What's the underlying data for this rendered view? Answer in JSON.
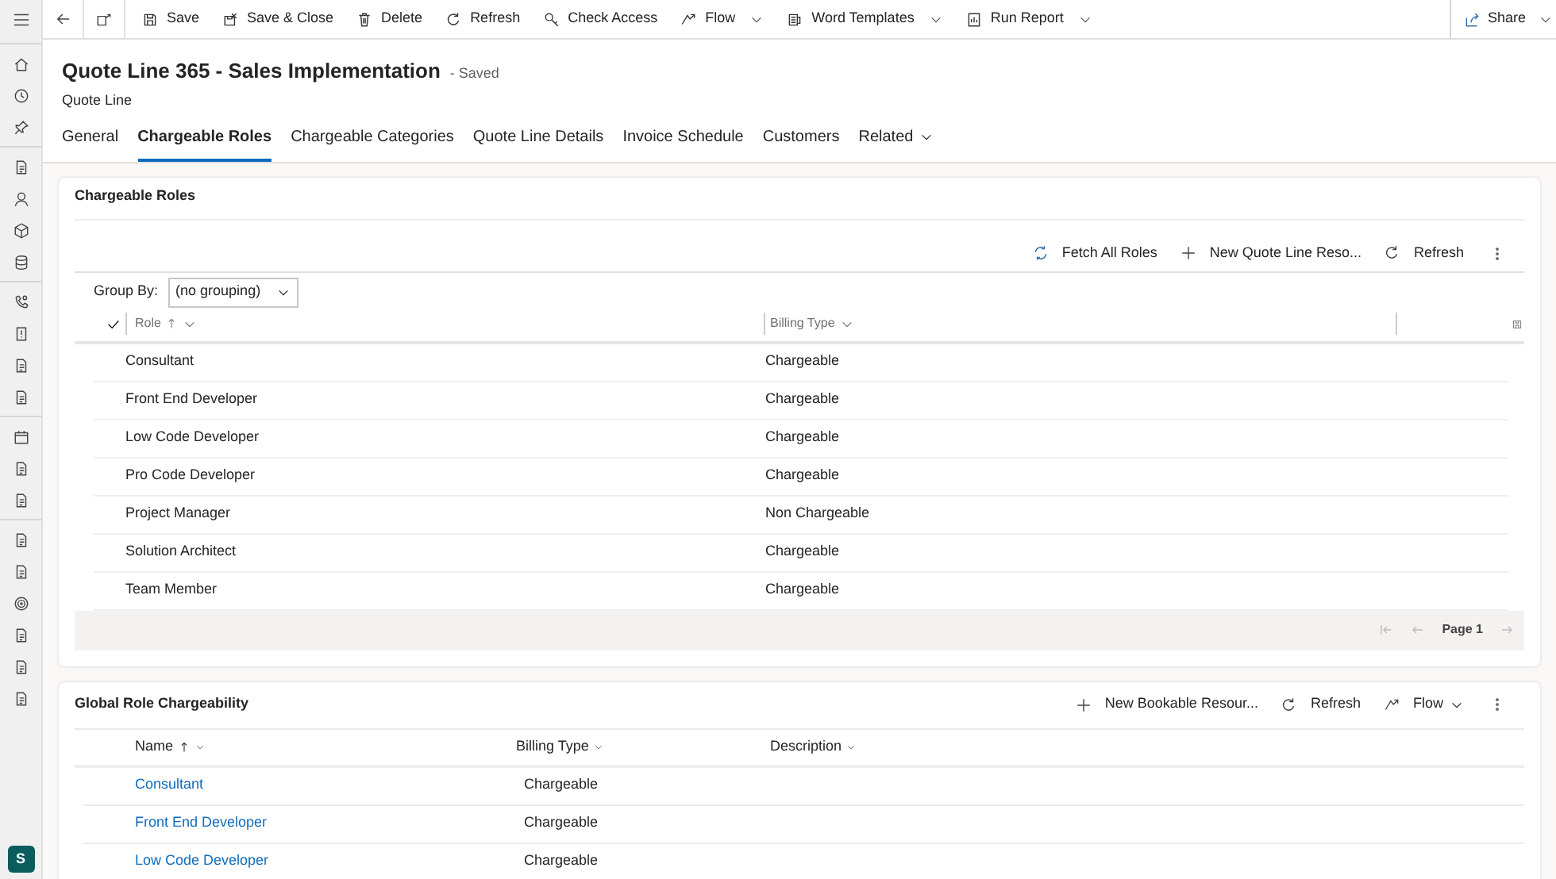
{
  "command_bar": {
    "commands": [
      {
        "label": "Save",
        "dropdown": false
      },
      {
        "label": "Save & Close",
        "dropdown": false
      },
      {
        "label": "Delete",
        "dropdown": false
      },
      {
        "label": "Refresh",
        "dropdown": false
      },
      {
        "label": "Check Access",
        "dropdown": false
      },
      {
        "label": "Flow",
        "dropdown": true
      },
      {
        "label": "Word Templates",
        "dropdown": true
      },
      {
        "label": "Run Report",
        "dropdown": true
      }
    ],
    "share": {
      "label": "Share",
      "dropdown": true
    }
  },
  "record": {
    "title": "Quote Line 365 - Sales Implementation",
    "status": "- Saved",
    "entity": "Quote Line"
  },
  "tabs": [
    {
      "label": "General",
      "selected": false
    },
    {
      "label": "Chargeable Roles",
      "selected": true
    },
    {
      "label": "Chargeable Categories",
      "selected": false
    },
    {
      "label": "Quote Line Details",
      "selected": false
    },
    {
      "label": "Invoice Schedule",
      "selected": false
    },
    {
      "label": "Customers",
      "selected": false
    },
    {
      "label": "Related",
      "selected": false
    }
  ],
  "chargeable_roles": {
    "title": "Chargeable Roles",
    "toolbar": [
      {
        "label": "Fetch All Roles",
        "dropdown": false
      },
      {
        "label": "New Quote Line Reso...",
        "dropdown": false
      },
      {
        "label": "Refresh",
        "dropdown": false
      }
    ],
    "group_by": {
      "label": "Group By:",
      "value": "(no grouping)"
    },
    "columns": [
      {
        "label": "Role",
        "sorted": true
      },
      {
        "label": "Billing Type",
        "sorted": false
      }
    ],
    "rows": [
      [
        "Consultant",
        "Chargeable"
      ],
      [
        "Front End Developer",
        "Chargeable"
      ],
      [
        "Low Code Developer",
        "Chargeable"
      ],
      [
        "Pro Code Developer",
        "Chargeable"
      ],
      [
        "Project Manager",
        "Non Chargeable"
      ],
      [
        "Solution Architect",
        "Chargeable"
      ],
      [
        "Team Member",
        "Chargeable"
      ]
    ],
    "page": "Page 1"
  },
  "global_role_chargeability": {
    "title": "Global Role Chargeability",
    "toolbar": [
      {
        "label": "New Bookable Resour...",
        "dropdown": false
      },
      {
        "label": "Refresh",
        "dropdown": false
      },
      {
        "label": "Flow",
        "dropdown": true
      }
    ],
    "columns": [
      {
        "label": "Name",
        "sorted": true
      },
      {
        "label": "Billing Type",
        "sorted": false
      },
      {
        "label": "Description",
        "sorted": false
      }
    ],
    "rows": [
      [
        "Consultant",
        "Chargeable"
      ],
      [
        "Front End Developer",
        "Chargeable"
      ],
      [
        "Low Code Developer",
        "Chargeable"
      ]
    ]
  },
  "user": {
    "initial": "S"
  }
}
